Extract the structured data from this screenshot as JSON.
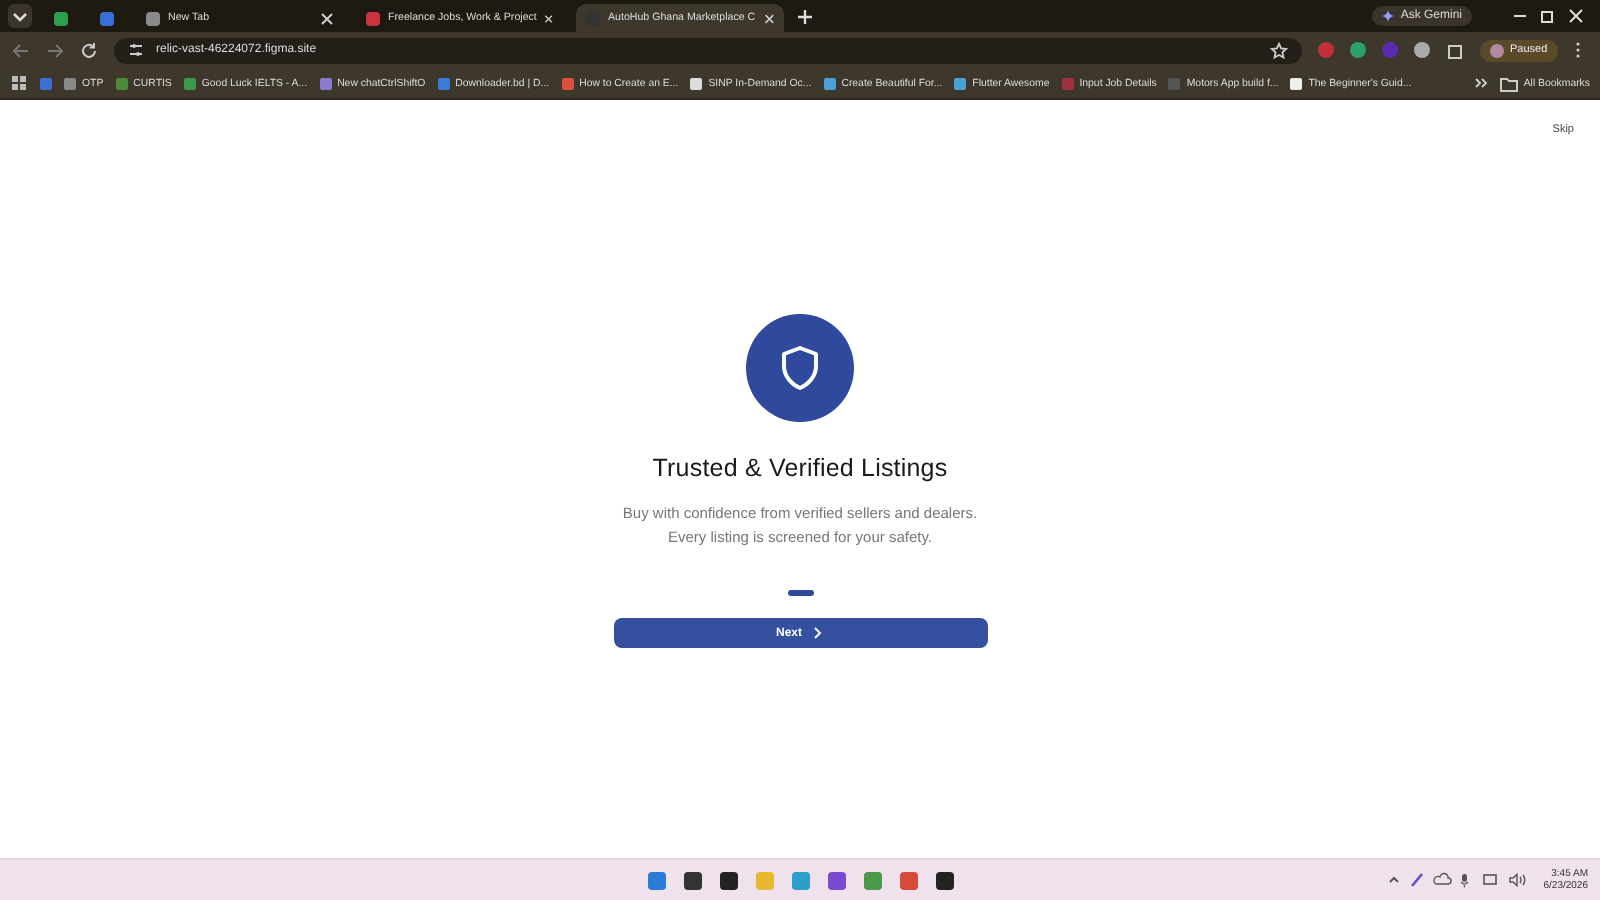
{
  "browser": {
    "tabs": [
      {
        "selected": false
      },
      {
        "selected": false
      },
      {
        "title": "New Tab",
        "selected": false
      },
      {
        "title": "Freelance Jobs, Work & Project",
        "selected": false
      },
      {
        "title": "AutoHub Ghana Marketplace C",
        "selected": true
      }
    ],
    "ask_button": "Ask Gemini",
    "url": "relic-vast-46224072.figma.site",
    "profile": "Paused",
    "bookmarks": [
      "OTP",
      "CURTIS",
      "Good Luck IELTS - A...",
      "New chatCtrlShiftO",
      "Downloader.bd | D...",
      "How to Create an E...",
      "SINP In-Demand Oc...",
      "Create Beautiful For...",
      "Flutter Awesome",
      "Input Job Details",
      "Motors App build f...",
      "The Beginner's Guid..."
    ],
    "all_bookmarks": "All Bookmarks"
  },
  "page": {
    "skip": "Skip",
    "title": "Trusted & Verified Listings",
    "lines": [
      "Buy with confidence from verified sellers and dealers.",
      "Every listing is screened for your safety."
    ],
    "dots": [
      {
        "selected": true
      }
    ],
    "next": "Next"
  },
  "taskbar": {
    "time": "3:45 AM",
    "date": "6/23/2026"
  }
}
